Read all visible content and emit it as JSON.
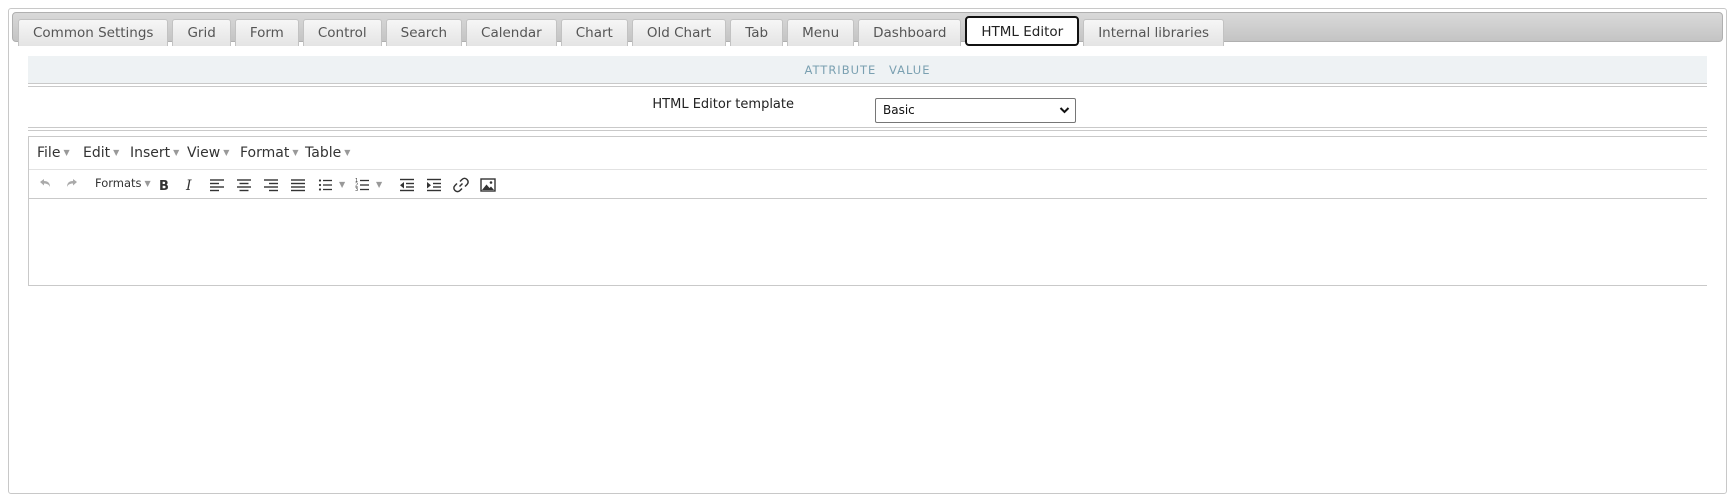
{
  "tabs": [
    {
      "label": "Common Settings"
    },
    {
      "label": "Grid"
    },
    {
      "label": "Form"
    },
    {
      "label": "Control"
    },
    {
      "label": "Search"
    },
    {
      "label": "Calendar"
    },
    {
      "label": "Chart"
    },
    {
      "label": "Old Chart"
    },
    {
      "label": "Tab"
    },
    {
      "label": "Menu"
    },
    {
      "label": "Dashboard"
    },
    {
      "label": "HTML Editor",
      "active": true
    },
    {
      "label": "Internal libraries"
    }
  ],
  "attributes": {
    "header_attribute": "ATTRIBUTE",
    "header_value": "VALUE",
    "template_label": "HTML Editor template",
    "template_value": "Basic"
  },
  "editor": {
    "menu": {
      "file": "File",
      "edit": "Edit",
      "insert": "Insert",
      "view": "View",
      "format": "Format",
      "table": "Table"
    },
    "toolbar": {
      "formats": "Formats"
    },
    "content": ""
  },
  "colors": {
    "header_bg": "#eef2f4",
    "header_text": "#7aa0b1",
    "tabbar_bg": "#c4c4c4",
    "active_tab_border": "#111111"
  },
  "icons": [
    "undo-icon",
    "redo-icon",
    "bold-icon",
    "italic-icon",
    "align-left-icon",
    "align-center-icon",
    "align-right-icon",
    "align-justify-icon",
    "bullet-list-icon",
    "numbered-list-icon",
    "outdent-icon",
    "indent-icon",
    "link-icon",
    "image-icon"
  ]
}
